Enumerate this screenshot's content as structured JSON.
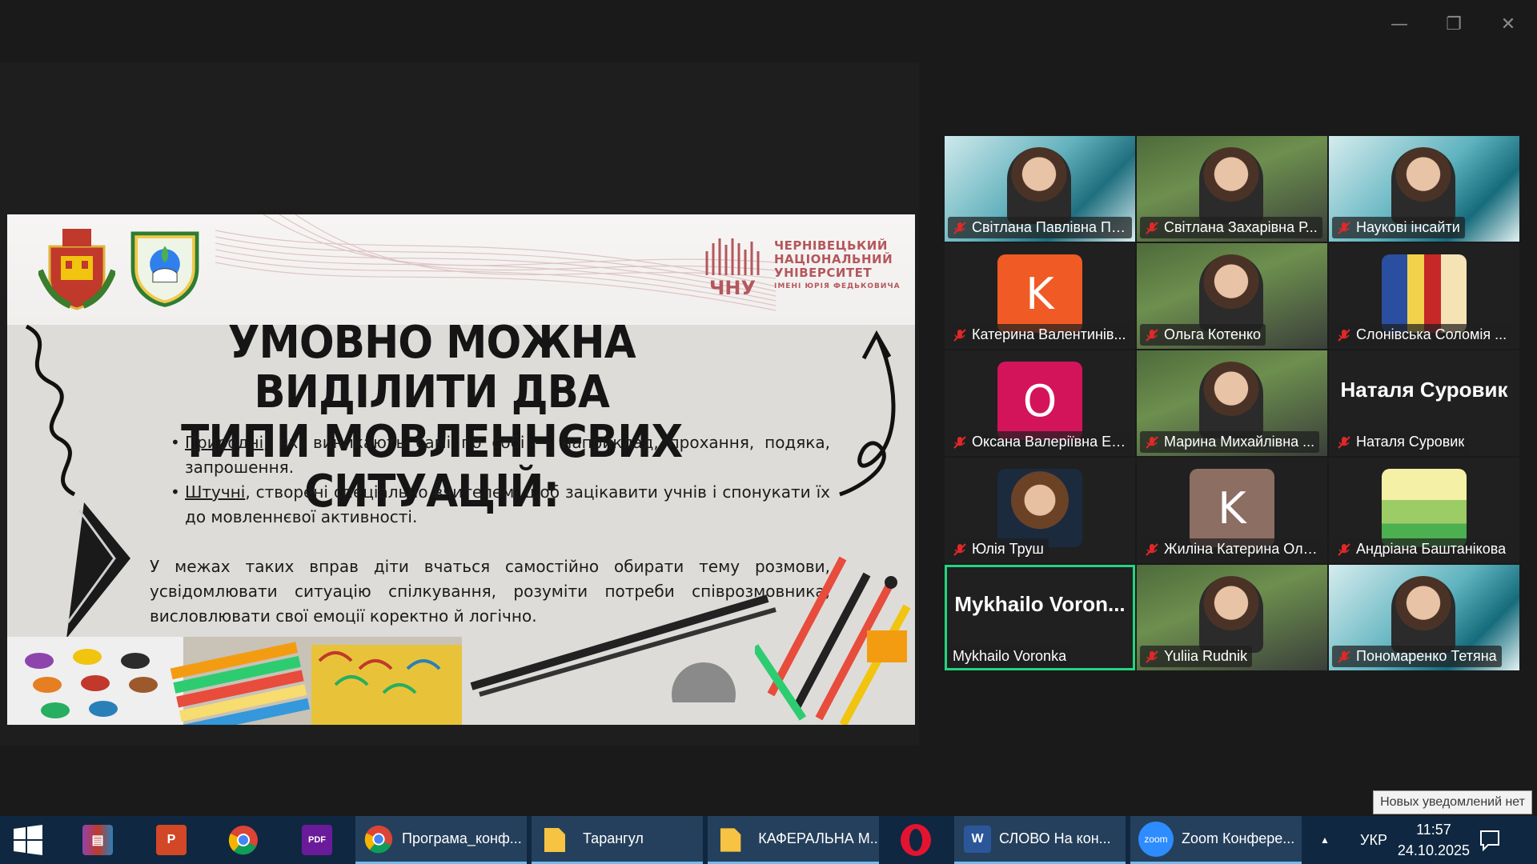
{
  "window": {
    "minimize_icon": "minimize-icon",
    "restore_icon": "restore-icon",
    "close_icon": "close-icon"
  },
  "slide": {
    "university_line1": "ЧЕРНІВЕЦЬКИЙ",
    "university_line2": "НАЦІОНАЛЬНИЙ",
    "university_line3": "УНІВЕРСИТЕТ",
    "university_line4": "ІМЕНІ ЮРІЯ ФЕДЬКОВИЧА",
    "title_line1": "УМОВНО МОЖНА ВИДІЛИТИ ДВА",
    "title_line2": "ТИПИ МОВЛЕННЄВИХ СИТУАЦІЙ:",
    "bullet1_term": "Природні",
    "bullet1_rest": ", які виникають самі по собі — наприклад, прохання, подяка, запрошення.",
    "bullet2_term": "Штучні",
    "bullet2_rest": ", створені спеціально вчителем, щоб зацікавити учнів і спонукати їх до мовленнєвої активності.",
    "paragraph": "У межах таких вправ діти вчаться самостійно обирати тему розмови, усвідомлювати ситуацію спілкування, розуміти потреби співрозмовника, висловлювати свої емоції коректно й логічно."
  },
  "gallery": [
    {
      "name": "Світлана Павлівна Па...",
      "muted": true,
      "kind": "video"
    },
    {
      "name": "Світлана Захарівна Р...",
      "muted": true,
      "kind": "video"
    },
    {
      "name": "Наукові інсайти",
      "muted": true,
      "kind": "video"
    },
    {
      "name": "Катерина Валентинів...",
      "muted": true,
      "kind": "letter",
      "letter": "K",
      "color": "#f05a24"
    },
    {
      "name": "Ольга Котенко",
      "muted": true,
      "kind": "video"
    },
    {
      "name": "Слонівська Соломія ...",
      "muted": true,
      "kind": "photo"
    },
    {
      "name": "Оксана Валеріївна Ел...",
      "muted": true,
      "kind": "letter",
      "letter": "O",
      "color": "#d4145a"
    },
    {
      "name": "Марина Михайлівна ...",
      "muted": true,
      "kind": "video"
    },
    {
      "name": "Наталя Суровик",
      "muted": true,
      "kind": "text",
      "bigname": "Наталя Суровик"
    },
    {
      "name": "Юлія Труш",
      "muted": true,
      "kind": "photo"
    },
    {
      "name": "Жиліна Катерина Оле...",
      "muted": true,
      "kind": "letter",
      "letter": "K",
      "color": "#8d6e63"
    },
    {
      "name": "Андріана Баштанікова",
      "muted": true,
      "kind": "photo"
    },
    {
      "name": "Mykhailo Voronka",
      "muted": false,
      "kind": "text",
      "bigname": "Mykhailo  Voron...",
      "active": true
    },
    {
      "name": "Yuliia Rudnik",
      "muted": true,
      "kind": "video"
    },
    {
      "name": "Пономаренко Тетяна",
      "muted": true,
      "kind": "video"
    }
  ],
  "taskbar": {
    "start_icon": "windows-start-icon",
    "apps": [
      {
        "icon": "winrar-icon"
      },
      {
        "icon": "powerpoint-icon",
        "glyph": "P"
      },
      {
        "icon": "chrome-icon"
      },
      {
        "icon": "pdf-icon",
        "glyph": "PDF"
      },
      {
        "icon": "chrome-icon",
        "label": "Програма_конф..."
      },
      {
        "icon": "folder-icon",
        "label": "Тарангул"
      },
      {
        "icon": "folder-icon",
        "label": "КАФЕРАЛЬНА М..."
      },
      {
        "icon": "opera-icon"
      },
      {
        "icon": "word-icon",
        "label": "СЛОВО На кон..."
      },
      {
        "icon": "zoom-icon",
        "glyph": "zoom",
        "label": "Zoom Конфере..."
      }
    ],
    "tray_arrow": "▲",
    "language": "УКР",
    "time": "11:57",
    "date": "24.10.2025",
    "notification_icon": "notification-icon",
    "notification_tooltip": "Новых уведомлений нет"
  }
}
